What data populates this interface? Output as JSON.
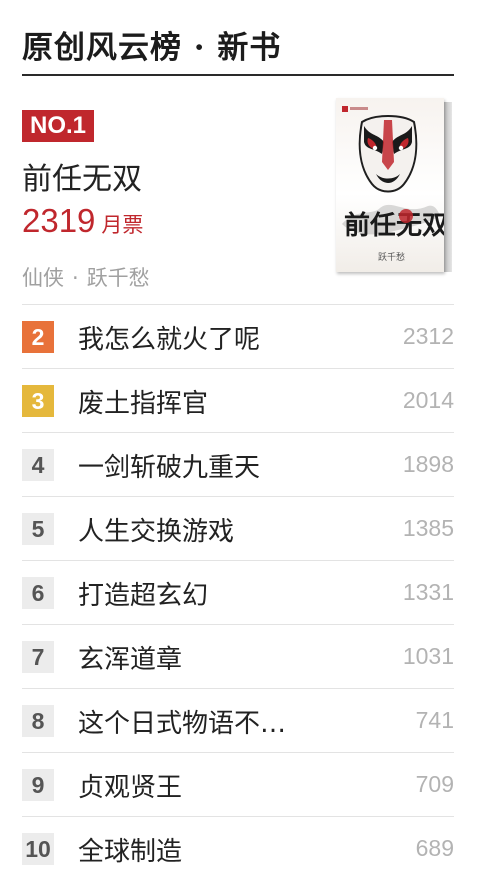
{
  "header": {
    "title": "原创风云榜 · 新书"
  },
  "featured": {
    "rank_badge": "NO.1",
    "title": "前任无双",
    "tickets": "2319",
    "tickets_unit": "月票",
    "genre": "仙侠",
    "separator": "·",
    "author": "跃千愁",
    "cover_text": "前任无双",
    "cover_author": "跃千愁"
  },
  "colors": {
    "accent": "#c0272d",
    "rank2": "#e8723a",
    "rank3": "#e5b83c",
    "muted": "#b3b3b3"
  },
  "list": [
    {
      "rank": "2",
      "title": "我怎么就火了呢",
      "count": "2312"
    },
    {
      "rank": "3",
      "title": "废土指挥官",
      "count": "2014"
    },
    {
      "rank": "4",
      "title": "一剑斩破九重天",
      "count": "1898"
    },
    {
      "rank": "5",
      "title": "人生交换游戏",
      "count": "1385"
    },
    {
      "rank": "6",
      "title": "打造超玄幻",
      "count": "1331"
    },
    {
      "rank": "7",
      "title": "玄浑道章",
      "count": "1031"
    },
    {
      "rank": "8",
      "title": "这个日式物语不…",
      "count": "741"
    },
    {
      "rank": "9",
      "title": "贞观贤王",
      "count": "709"
    },
    {
      "rank": "10",
      "title": "全球制造",
      "count": "689"
    }
  ]
}
